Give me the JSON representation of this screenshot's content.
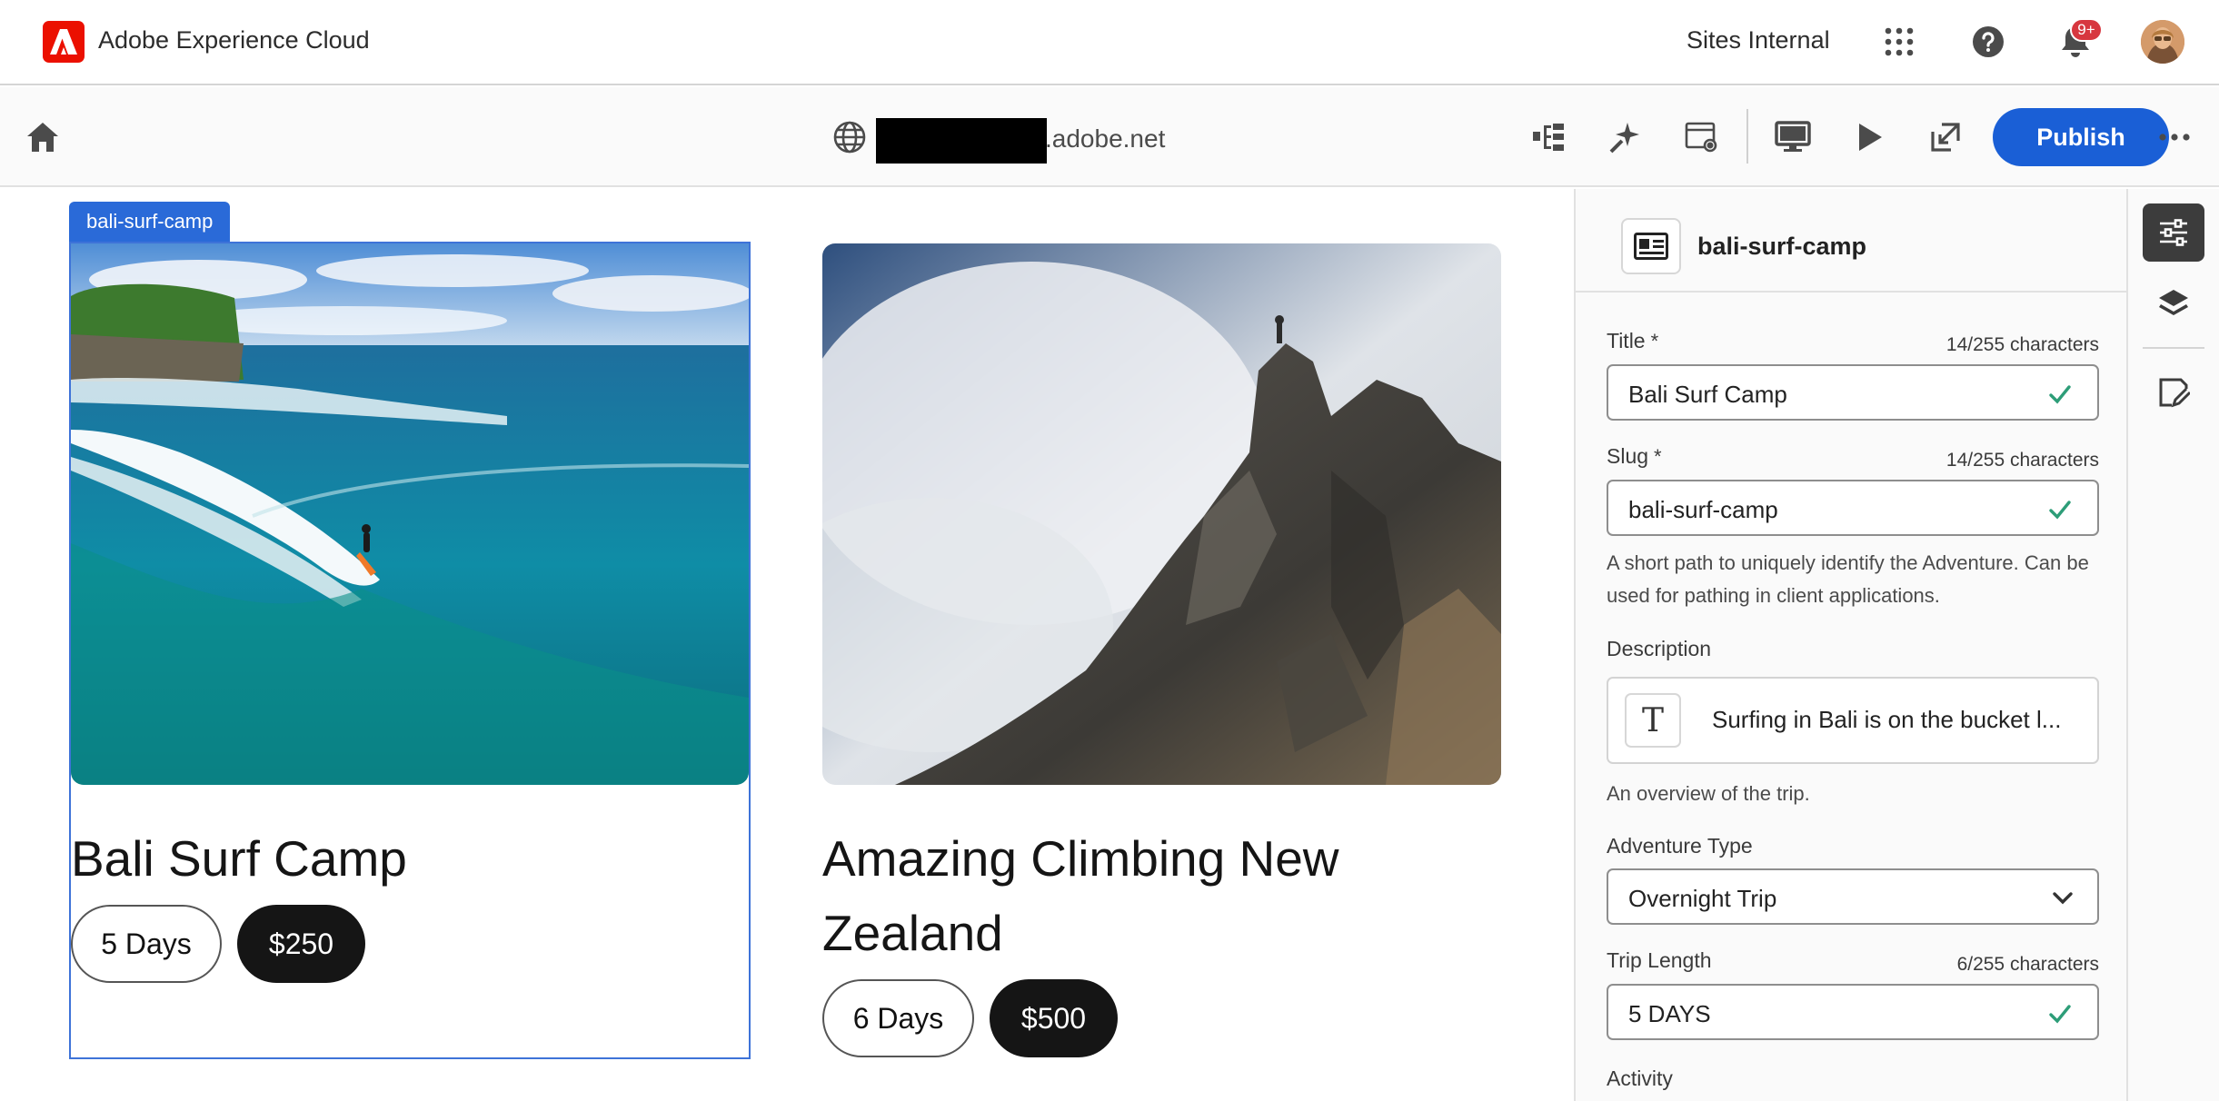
{
  "shell": {
    "brand": "Adobe Experience Cloud",
    "org": "Sites Internal",
    "notification_badge": "9+",
    "icons": [
      "adobe-logo-icon",
      "apps-grid-icon",
      "help-icon",
      "bell-icon",
      "user-avatar"
    ]
  },
  "toolbar": {
    "url_host": ".adobe.net",
    "publish_label": "Publish",
    "icons": [
      "home-icon",
      "globe-icon",
      "content-tree-icon",
      "sparkle-icon",
      "page-settings-icon",
      "desktop-preview-icon",
      "play-icon",
      "open-in-new-icon",
      "more-icon"
    ]
  },
  "canvas": {
    "selected_label": "bali-surf-camp",
    "cards": [
      {
        "title": "Bali Surf Camp",
        "length": "5 Days",
        "price": "$250"
      },
      {
        "title_line1": "Amazing Climbing New",
        "title_line2": "Zealand",
        "length": "6 Days",
        "price": "$500"
      }
    ]
  },
  "panel": {
    "component_name": "bali-surf-camp",
    "fields": {
      "title": {
        "label": "Title",
        "required": "*",
        "count": "14/255 characters",
        "value": "Bali Surf Camp"
      },
      "slug": {
        "label": "Slug",
        "required": "*",
        "count": "14/255 characters",
        "value": "bali-surf-camp",
        "help": "A short path to uniquely identify the Adventure. Can be used for pathing in client applications."
      },
      "description": {
        "label": "Description",
        "value": "Surfing in Bali is on the bucket l...",
        "help": "An overview of the trip."
      },
      "adventure_type": {
        "label": "Adventure Type",
        "value": "Overnight Trip"
      },
      "trip_length": {
        "label": "Trip Length",
        "count": "6/255 characters",
        "value": "5 DAYS"
      },
      "activity": {
        "label": "Activity"
      }
    }
  },
  "rail": {
    "icons": [
      "properties-icon",
      "layers-icon",
      "edit-note-icon"
    ]
  },
  "colors": {
    "accent": "#1a5fd6",
    "selection": "#2a6ad8",
    "valid": "#2d9d78",
    "adobe_red": "#eb1000"
  }
}
